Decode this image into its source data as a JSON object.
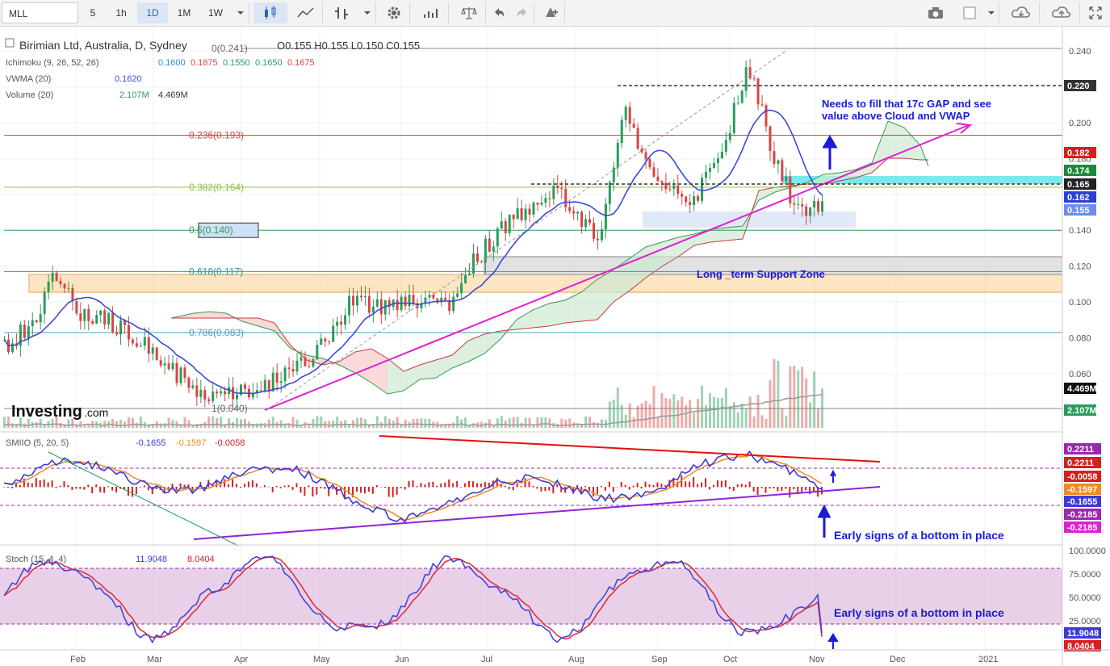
{
  "toolbar": {
    "symbol": "MLL",
    "intervals": [
      "5",
      "1h",
      "1D",
      "1M",
      "1W"
    ],
    "active_interval": "1D",
    "icons": [
      "candles-icon",
      "line-chart-icon",
      "bars-icon",
      "gear-icon",
      "indicators-icon",
      "scale-icon",
      "undo-icon",
      "redo-icon",
      "alert-icon",
      "camera-icon",
      "square-icon",
      "cloud-download-icon",
      "cloud-upload-icon",
      "fullscreen-icon"
    ]
  },
  "legend": {
    "title": "Birimian Ltd, Australia, D, Sydney",
    "ohlc": "O0.155  H0.155  L0.150  C0.155",
    "ichimoku_label": "Ichimoku (9, 26, 52, 26)",
    "ichimoku_values": [
      "0.1600",
      "0.1875",
      "0.1550",
      "0.1650",
      "0.1675"
    ],
    "vwma_label": "VWMA (20)",
    "vwma_value": "0.1620",
    "volume_label": "Volume (20)",
    "volume_values": [
      "2.107M",
      "4.469M"
    ],
    "smiio_label": "SMIIO (5, 20, 5)",
    "smiio_values": [
      "-0.1655",
      "-0.1597",
      "-0.0058"
    ],
    "stoch_label": "Stoch (15, 4, 4)",
    "stoch_values": [
      "11.9048",
      "8.0404"
    ]
  },
  "annotations": {
    "gap_note_1": "Needs to fill that 17c GAP and see",
    "gap_note_2": "value above Cloud and VWAP",
    "support_zone": "Long _term Support Zone",
    "bottom_note_smiio": "Early signs of a bottom in place",
    "bottom_note_stoch": "Early signs of a bottom in place",
    "fib_0": "0(0.241)",
    "fib_236": "0.236(0.193)",
    "fib_382": "0.382(0.164)",
    "fib_500": "0.5(0.140)",
    "fib_618": "0.618(0.117)",
    "fib_786": "0.786(0.083)",
    "fib_1": "1(0.040)",
    "watermark_main": "Investing",
    "watermark_suffix": ".com"
  },
  "colors": {
    "up": "#2a9d5c",
    "down": "#d64545",
    "vwma": "#3b4bd6",
    "trendline": "#e020d0",
    "annotation": "#1a1ad8",
    "smi_main": "#3b3bd9",
    "smi_signal": "#f08a24",
    "stoch_k": "#4646d8",
    "stoch_d": "#e0303a"
  },
  "chart_data": {
    "type": "candlestick",
    "symbol": "MLL",
    "interval": "1D",
    "y_axis_price": {
      "min": 0.04,
      "max": 0.245,
      "ticks": [
        "0.240",
        "0.220",
        "0.200",
        "0.180",
        "0.160",
        "0.140",
        "0.120",
        "0.100",
        "0.080",
        "0.060"
      ]
    },
    "price_tags": [
      "0.220",
      "0.182",
      "0.174",
      "0.165",
      "0.162",
      "0.155",
      "4.469M",
      "2.107M"
    ],
    "x_axis_labels": [
      "Feb",
      "Mar",
      "Apr",
      "May",
      "Jun",
      "Jul",
      "Aug",
      "Sep",
      "Oct",
      "Nov",
      "Dec",
      "2021"
    ],
    "close_path": [
      [
        "Jan",
        0.075
      ],
      [
        "Jan",
        0.087
      ],
      [
        "Jan",
        0.113
      ],
      [
        "Feb",
        0.095
      ],
      [
        "Feb",
        0.091
      ],
      [
        "Feb",
        0.085
      ],
      [
        "Mar",
        0.072
      ],
      [
        "Mar",
        0.06
      ],
      [
        "Mar",
        0.05
      ],
      [
        "Apr",
        0.049
      ],
      [
        "Apr",
        0.051
      ],
      [
        "Apr",
        0.058
      ],
      [
        "May",
        0.066
      ],
      [
        "May",
        0.079
      ],
      [
        "May",
        0.102
      ],
      [
        "Jun",
        0.099
      ],
      [
        "Jun",
        0.098
      ],
      [
        "Jun",
        0.099
      ],
      [
        "Jul",
        0.101
      ],
      [
        "Jul",
        0.123
      ],
      [
        "Jul",
        0.141
      ],
      [
        "Jul",
        0.152
      ],
      [
        "Aug",
        0.16
      ],
      [
        "Aug",
        0.155
      ],
      [
        "Aug",
        0.13
      ],
      [
        "Sep",
        0.205
      ],
      [
        "Sep",
        0.175
      ],
      [
        "Sep",
        0.16
      ],
      [
        "Oct",
        0.16
      ],
      [
        "Oct",
        0.185
      ],
      [
        "Oct",
        0.232
      ],
      [
        "Oct",
        0.185
      ],
      [
        "Nov",
        0.15
      ],
      [
        "Nov",
        0.155
      ]
    ],
    "fibonacci": [
      {
        "level": "0",
        "price": 0.241
      },
      {
        "level": "0.236",
        "price": 0.193
      },
      {
        "level": "0.382",
        "price": 0.164
      },
      {
        "level": "0.5",
        "price": 0.14
      },
      {
        "level": "0.618",
        "price": 0.117
      },
      {
        "level": "0.786",
        "price": 0.083
      },
      {
        "level": "1",
        "price": 0.04
      }
    ],
    "indicators": {
      "smiio": {
        "ticks": [
          "0.2211",
          "0.2211",
          "-0.0058",
          "-0.1597",
          "-0.1655",
          "-0.2185",
          "-0.2185"
        ],
        "last": {
          "smi": -0.1655,
          "signal": -0.1597,
          "osc": -0.0058
        }
      },
      "stoch": {
        "ticks": [
          "100.0000",
          "75.0000",
          "50.0000",
          "25.0000"
        ],
        "last": {
          "k": 11.9048,
          "d": 8.0404
        },
        "bands": [
          80,
          20
        ]
      }
    }
  }
}
